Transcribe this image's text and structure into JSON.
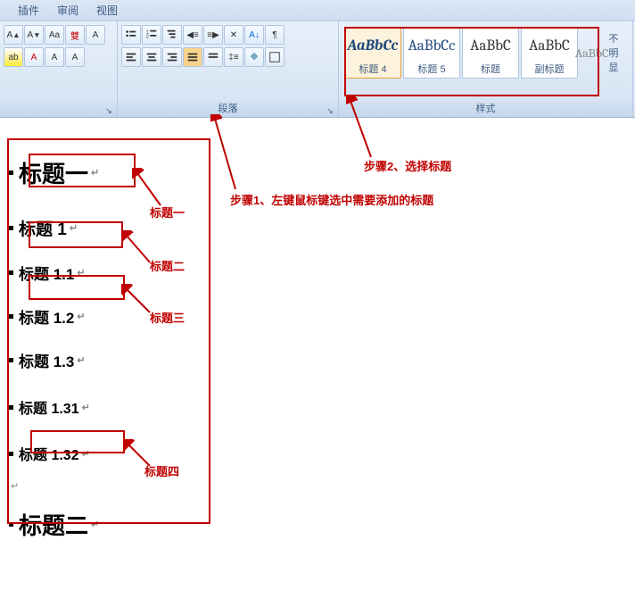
{
  "tabs": {
    "t1": "插件",
    "t2": "审阅",
    "t3": "视图"
  },
  "groups": {
    "paragraph": "段落",
    "styles": "样式"
  },
  "styles": {
    "s1": {
      "preview": "AaBbCc",
      "name": "标题 4"
    },
    "s2": {
      "preview": "AaBbCc",
      "name": "标题 5"
    },
    "s3": {
      "preview": "AaBbC",
      "name": "标题"
    },
    "s4": {
      "preview": "AaBbC",
      "name": "副标题"
    },
    "s5": {
      "preview": "AaBbC",
      "name": "不明显"
    }
  },
  "anno": {
    "step1": "步骤1、左键鼠标键选中需要添加的标题",
    "step2": "步骤2、选择标题",
    "l1": "标题一",
    "l2": "标题二",
    "l3": "标题三",
    "l4": "标题四"
  },
  "doc": {
    "d1": "标题一",
    "d2": "标题 1",
    "d3": "标题 1.1",
    "d4": "标题 1.2",
    "d5": "标题 1.3",
    "d6": "标题 1.31",
    "d7": "标题 1.32",
    "d8": "标题二"
  }
}
